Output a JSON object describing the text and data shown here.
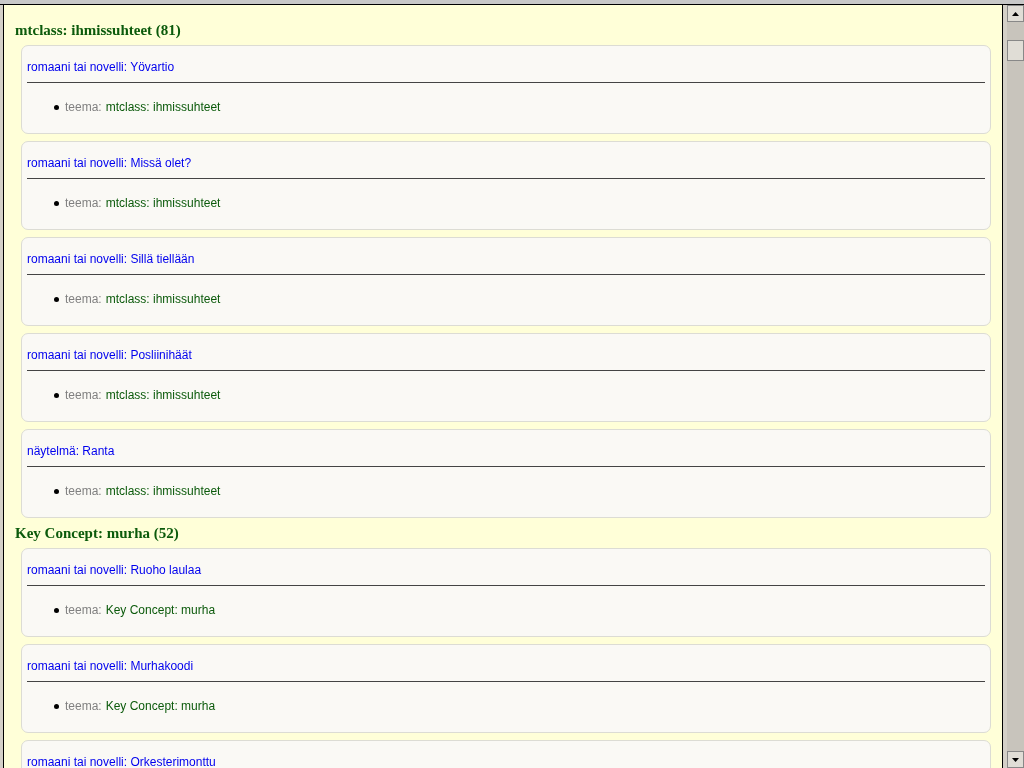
{
  "sections": [
    {
      "heading": "mtclass: ihmissuhteet (81)",
      "items": [
        {
          "title": "romaani tai novelli: Yövartio",
          "properties": [
            {
              "label": "teema:",
              "value": "mtclass: ihmissuhteet"
            }
          ]
        },
        {
          "title": "romaani tai novelli: Missä olet?",
          "properties": [
            {
              "label": "teema:",
              "value": "mtclass: ihmissuhteet"
            }
          ]
        },
        {
          "title": "romaani tai novelli: Sillä tiellään",
          "properties": [
            {
              "label": "teema:",
              "value": "mtclass: ihmissuhteet"
            }
          ]
        },
        {
          "title": "romaani tai novelli: Posliinihäät",
          "properties": [
            {
              "label": "teema:",
              "value": "mtclass: ihmissuhteet"
            }
          ]
        },
        {
          "title": "näytelmä: Ranta",
          "properties": [
            {
              "label": "teema:",
              "value": "mtclass: ihmissuhteet"
            }
          ]
        }
      ]
    },
    {
      "heading": "Key Concept: murha (52)",
      "items": [
        {
          "title": "romaani tai novelli: Ruoho laulaa",
          "properties": [
            {
              "label": "teema:",
              "value": "Key Concept: murha"
            }
          ]
        },
        {
          "title": "romaani tai novelli: Murhakoodi",
          "properties": [
            {
              "label": "teema:",
              "value": "Key Concept: murha"
            }
          ]
        },
        {
          "title": "romaani tai novelli: Orkesterimonttu"
        }
      ]
    }
  ]
}
